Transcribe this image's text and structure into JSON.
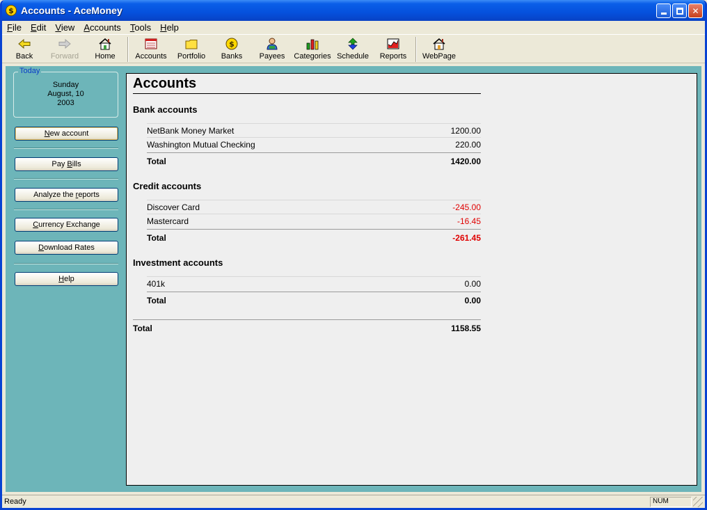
{
  "window": {
    "title": "Accounts - AceMoney",
    "app_icon_glyph": "$"
  },
  "menu": [
    {
      "key": "F",
      "rest": "ile"
    },
    {
      "key": "E",
      "rest": "dit"
    },
    {
      "key": "V",
      "rest": "iew"
    },
    {
      "key": "A",
      "rest": "ccounts"
    },
    {
      "key": "T",
      "rest": "ools"
    },
    {
      "key": "H",
      "rest": "elp"
    }
  ],
  "toolbar": {
    "back": "Back",
    "forward": "Forward",
    "home": "Home",
    "accounts": "Accounts",
    "portfolio": "Portfolio",
    "banks": "Banks",
    "payees": "Payees",
    "categories": "Categories",
    "schedule": "Schedule",
    "reports": "Reports",
    "webpage": "WebPage"
  },
  "today": {
    "label": "Today",
    "weekday": "Sunday",
    "date": "August, 10",
    "year": "2003"
  },
  "sidebar": {
    "new_account": {
      "pre": "",
      "key": "N",
      "post": "ew account"
    },
    "pay_bills": {
      "pre": "Pay ",
      "key": "B",
      "post": "ills"
    },
    "analyze": {
      "pre": "Analyze the ",
      "key": "r",
      "post": "eports"
    },
    "currency": {
      "pre": "",
      "key": "C",
      "post": "urrency Exchange"
    },
    "download": {
      "pre": "",
      "key": "D",
      "post": "ownload Rates"
    },
    "help": {
      "pre": "",
      "key": "H",
      "post": "elp"
    }
  },
  "main": {
    "title": "Accounts",
    "sections": [
      {
        "title": "Bank accounts",
        "rows": [
          {
            "name": "NetBank Money Market",
            "amount": "1200.00"
          },
          {
            "name": "Washington Mutual Checking",
            "amount": "220.00"
          }
        ],
        "total_label": "Total",
        "total": "1420.00"
      },
      {
        "title": "Credit accounts",
        "rows": [
          {
            "name": "Discover Card",
            "amount": "-245.00"
          },
          {
            "name": "Mastercard",
            "amount": "-16.45"
          }
        ],
        "total_label": "Total",
        "total": "-261.45"
      },
      {
        "title": "Investment accounts",
        "rows": [
          {
            "name": "401k",
            "amount": "0.00"
          }
        ],
        "total_label": "Total",
        "total": "0.00"
      }
    ],
    "grand_total_label": "Total",
    "grand_total": "1158.55"
  },
  "status": {
    "text": "Ready",
    "num": "NUM"
  },
  "colors": {
    "negative": "#e00000",
    "panel": "#6db5b9",
    "titlebar": "#0551dd"
  }
}
